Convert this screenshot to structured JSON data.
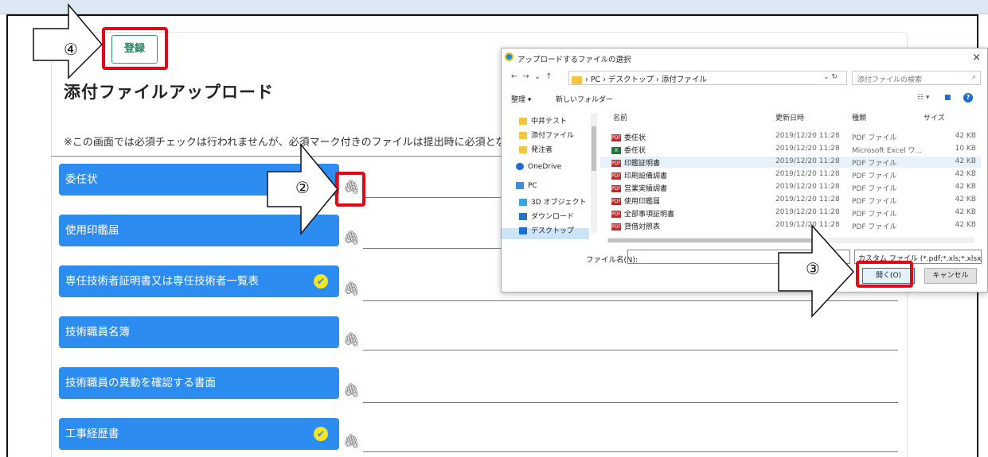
{
  "page": {
    "title": "添付ファイルアップロード",
    "register_label": "登録",
    "notice": "※この画面では必須チェックは行われませんが、必須マーク付きのファイルは提出時に必須となり"
  },
  "documents": [
    {
      "label": "委任状",
      "required": false
    },
    {
      "label": "使用印鑑届",
      "required": false
    },
    {
      "label": "専任技術者証明書又は専任技術者一覧表",
      "required": true
    },
    {
      "label": "技術職員名簿",
      "required": false
    },
    {
      "label": "技術職員の異動を確認する書面",
      "required": false
    },
    {
      "label": "工事経歴書",
      "required": true
    }
  ],
  "callouts": {
    "step2": "②",
    "step3": "③",
    "step4": "④"
  },
  "dialog": {
    "title": "アップロードするファイルの選択",
    "close": "×",
    "breadcrumb": "› PC › デスクトップ › 添付ファイル",
    "search_placeholder": "添付ファイルの検索",
    "organize": "整理 ▾",
    "new_folder": "新しいフォルダー",
    "tree": [
      {
        "label": "中井テスト",
        "icon": "folder-icon"
      },
      {
        "label": "添付ファイル",
        "icon": "folder-icon"
      },
      {
        "label": "発注者",
        "icon": "folder-icon"
      },
      {
        "label": "OneDrive",
        "icon": "cloud-icon"
      },
      {
        "label": "PC",
        "icon": "pc-icon"
      },
      {
        "label": "3D オブジェクト",
        "icon": "cube-icon"
      },
      {
        "label": "ダウンロード",
        "icon": "download-icon"
      },
      {
        "label": "デスクトップ",
        "icon": "desktop-icon"
      }
    ],
    "columns": {
      "name": "名前",
      "date": "更新日時",
      "type": "種類",
      "size": "サイズ"
    },
    "files": [
      {
        "name": "委任状",
        "date": "2019/12/20 11:28",
        "type": "PDF ファイル",
        "size": "42 KB",
        "kind": "pdf"
      },
      {
        "name": "委任状",
        "date": "2019/12/20 11:28",
        "type": "Microsoft Excel ワ...",
        "size": "10 KB",
        "kind": "excel"
      },
      {
        "name": "印鑑証明書",
        "date": "2019/12/20 11:28",
        "type": "PDF ファイル",
        "size": "42 KB",
        "kind": "pdf"
      },
      {
        "name": "印刷設備調書",
        "date": "2019/12/20 11:28",
        "type": "PDF ファイル",
        "size": "42 KB",
        "kind": "pdf"
      },
      {
        "name": "営業実績調書",
        "date": "2019/12/20 11:28",
        "type": "PDF ファイル",
        "size": "42 KB",
        "kind": "pdf"
      },
      {
        "name": "使用印鑑届",
        "date": "2019/12/20 11:28",
        "type": "PDF ファイル",
        "size": "42 KB",
        "kind": "pdf"
      },
      {
        "name": "全部事項証明書",
        "date": "2019/12/20 11:28",
        "type": "PDF ファイル",
        "size": "42 KB",
        "kind": "pdf"
      },
      {
        "name": "貸借対照表",
        "date": "2019/12/20 11:28",
        "type": "PDF ファイル",
        "size": "42 KB",
        "kind": "pdf"
      }
    ],
    "filename_label": "ファイル名(N):",
    "filetype": "カスタム ファイル (*.pdf;*.xls;*.xlsx; ∨",
    "open_label": "開く(O)",
    "cancel_label": "キャンセル"
  },
  "colors": {
    "accent": "#2d8cf0",
    "highlight": "#e30613",
    "register": "#1d7f55",
    "check": "#f3e522"
  }
}
